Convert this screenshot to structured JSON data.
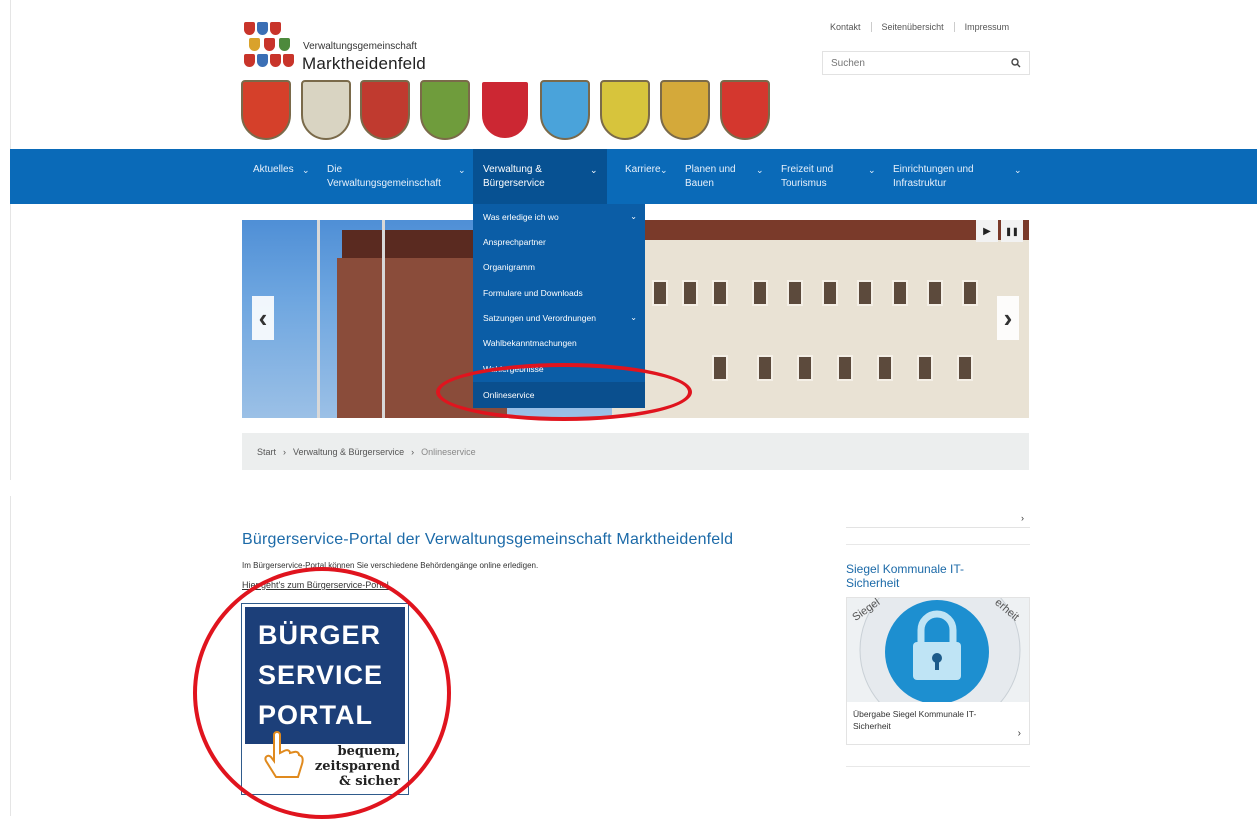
{
  "header": {
    "org_small": "Verwaltungsgemeinschaft",
    "org_name": "Marktheidenfeld",
    "top_links": [
      "Kontakt",
      "Seitenübersicht",
      "Impressum"
    ],
    "search_placeholder": "Suchen",
    "search_icon": "search-icon"
  },
  "nav": {
    "items": [
      {
        "label": "Aktuelles"
      },
      {
        "label": "Die\nVerwaltungsgemeinschaft"
      },
      {
        "label": "Verwaltung &\nBürgerservice"
      },
      {
        "label": "Karriere"
      },
      {
        "label": "Planen und\nBauen"
      },
      {
        "label": "Freizeit und\nTourismus"
      },
      {
        "label": "Einrichtungen und\nInfrastruktur"
      }
    ],
    "chevron_icon": "chevron-down-icon",
    "accent_color": "#0a6ab8"
  },
  "dropdown": {
    "items": [
      {
        "label": "Was erledige ich wo"
      },
      {
        "label": "Ansprechpartner"
      },
      {
        "label": "Organigramm"
      },
      {
        "label": "Formulare und Downloads"
      },
      {
        "label": "Satzungen und Verordnungen"
      },
      {
        "label": "Wahlbekanntmachungen"
      },
      {
        "label": "Wahlergebnisse"
      },
      {
        "label": "Onlineservice"
      }
    ]
  },
  "slider": {
    "prev": "‹",
    "next": "›",
    "play": "▶",
    "pause": "❚❚"
  },
  "breadcrumb": {
    "items": [
      "Start",
      "Verwaltung & Bürgerservice",
      "Onlineservice"
    ],
    "separator": "›"
  },
  "main": {
    "title": "Bürgerservice-Portal der Verwaltungsgemeinschaft Marktheidenfeld",
    "description": "Im Bürgerservice-Portal können Sie verschiedene Behördengänge online erledigen.",
    "link_text": "Hier geht's zum Bürgerservice-Portal.",
    "logo": {
      "lines": [
        "BÜRGER",
        "SERVICE",
        "PORTAL"
      ],
      "tagline": [
        "bequem,",
        "zeitsparend",
        "& sicher"
      ]
    }
  },
  "sidebar": {
    "siegel_title": "Siegel Kommunale IT-Sicherheit",
    "siegel_caption": "Übergabe Siegel Kommunale IT-Sicherheit",
    "chevron": "›",
    "stamp_text": [
      "Siegel",
      "erheit"
    ]
  }
}
